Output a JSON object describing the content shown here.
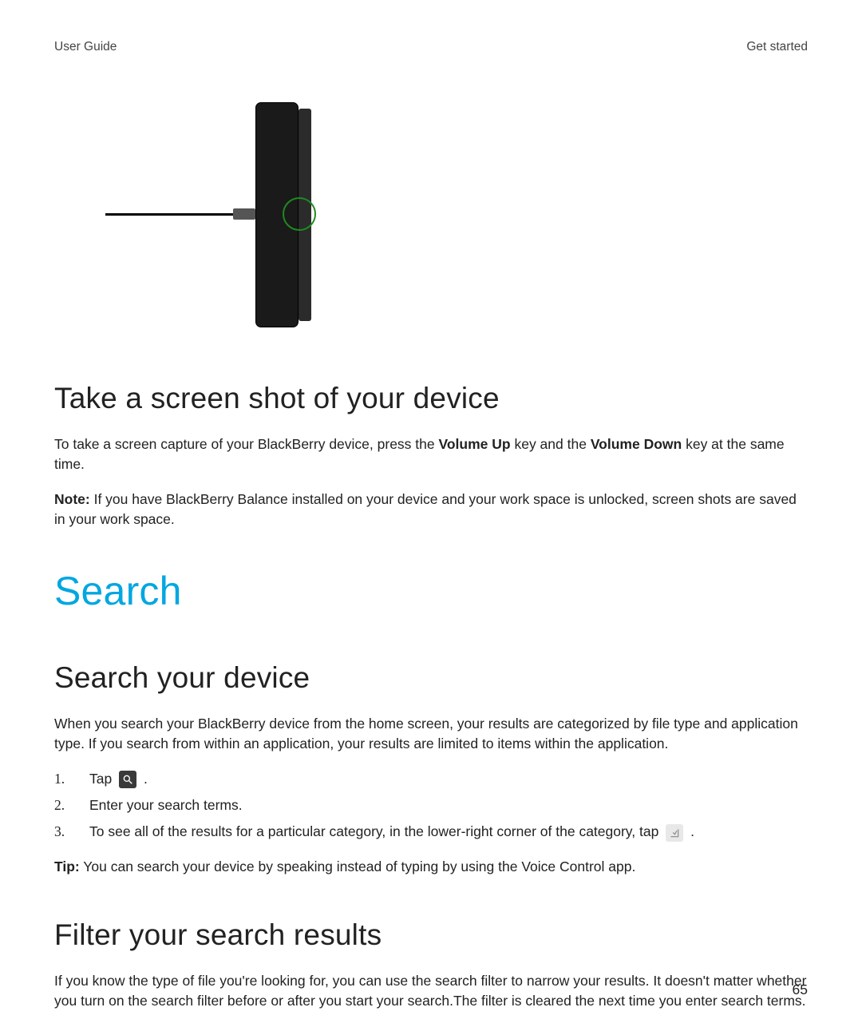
{
  "header": {
    "left": "User Guide",
    "right": "Get started"
  },
  "figure": {
    "alt": "BlackBerry device with USB cable plugged into side port"
  },
  "topic1": {
    "title": "Take a screen shot of your device",
    "para_pre": "To take a screen capture of your BlackBerry device, press the ",
    "key1": "Volume Up",
    "para_mid": " key and the ",
    "key2": "Volume Down",
    "para_post": " key at the same time.",
    "note_label": "Note:",
    "note_body": " If you have BlackBerry Balance installed on your device and your work space is unlocked, screen shots are saved in your work space."
  },
  "section": {
    "title": "Search"
  },
  "topic2": {
    "title": "Search your device",
    "intro": "When you search your BlackBerry device from the home screen, your results are categorized by file type and application type. If you search from within an application, your results are limited to items within the application.",
    "steps": {
      "s1_pre": "Tap ",
      "s1_icon": "search-icon",
      "s1_post": " .",
      "s2": "Enter your search terms.",
      "s3_pre": "To see all of the results for a particular category, in the lower-right corner of the category, tap ",
      "s3_icon": "expand-icon",
      "s3_post": " ."
    },
    "tip_label": "Tip:",
    "tip_body": " You can search your device by speaking instead of typing by using the Voice Control app."
  },
  "topic3": {
    "title": "Filter your search results",
    "body": "If you know the type of file you're looking for, you can use the search filter to narrow your results. It doesn't matter whether you turn on the search filter before or after you start your search.The filter is cleared the next time you enter search terms."
  },
  "page_number": "65"
}
